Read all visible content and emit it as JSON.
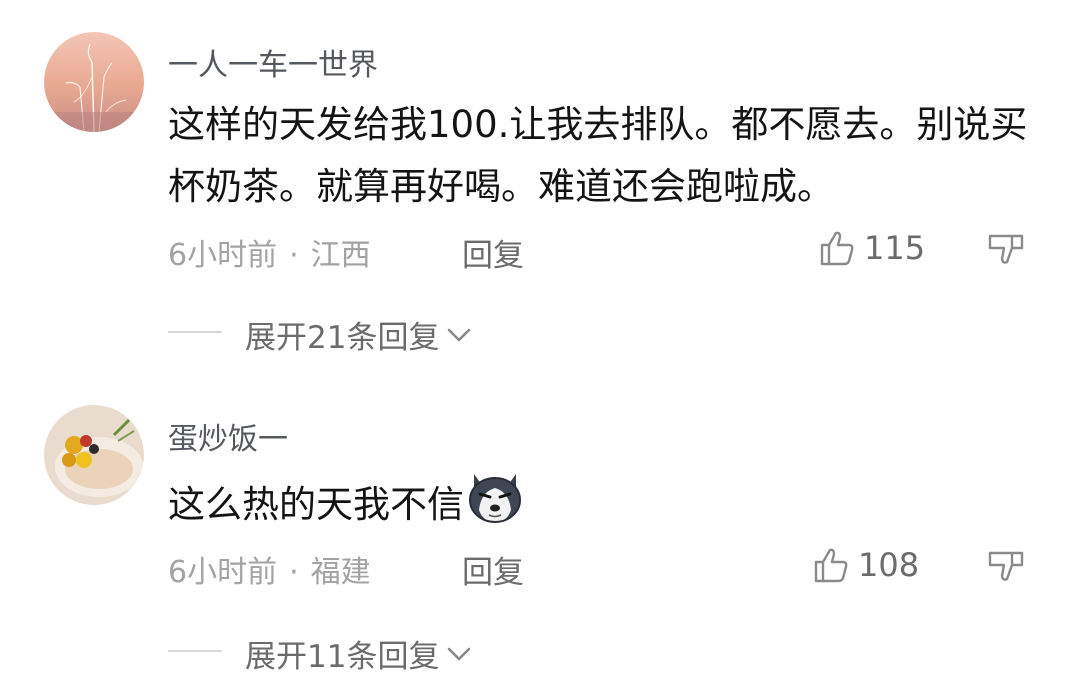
{
  "comments": [
    {
      "username": "一人一车一世界",
      "text": "这样的天发给我100.让我去排队。都不愿去。别说买杯奶茶。就算再好喝。难道还会跑啦成。",
      "time": "6小时前",
      "separator": "·",
      "location": "江西",
      "reply_label": "回复",
      "likes": "115",
      "expand_label": "展开21条回复",
      "avatar_icon": "reed-sunset-avatar"
    },
    {
      "username": "蛋炒饭一",
      "text": "这么热的天我不信",
      "emoji": "husky-dog-emoji",
      "time": "6小时前",
      "separator": "·",
      "location": "福建",
      "reply_label": "回复",
      "likes": "108",
      "expand_label": "展开11条回复",
      "avatar_icon": "food-plate-avatar"
    }
  ],
  "colors": {
    "username": "#55595e",
    "text": "#141414",
    "meta": "#a3a3a3",
    "action": "#6b6b6b"
  }
}
